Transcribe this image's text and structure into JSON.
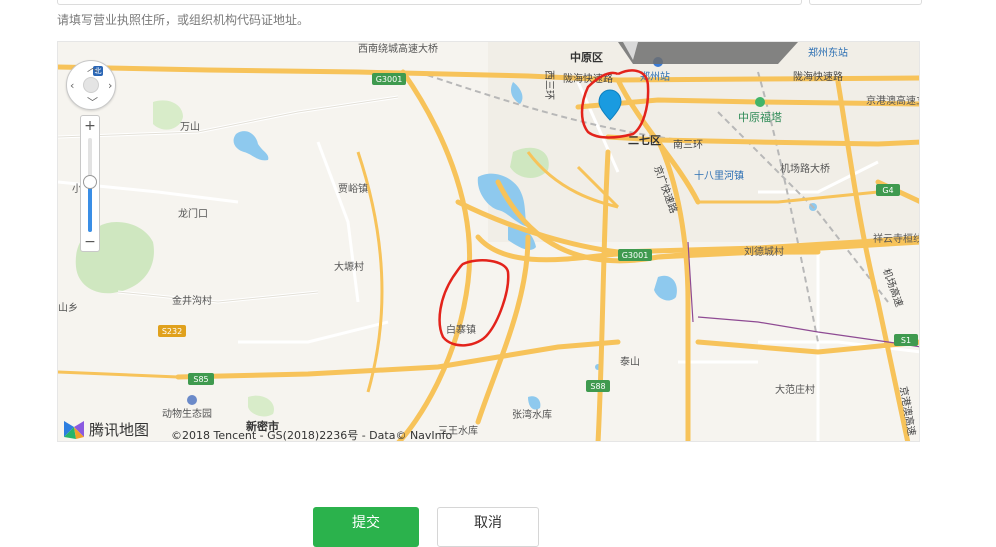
{
  "form": {
    "hint": "请填写营业执照住所，或组织机构代码证地址。",
    "submit_label": "提交",
    "cancel_label": "取消"
  },
  "map": {
    "provider_name": "腾讯地图",
    "copyright": "©2018 Tencent - GS(2018)2236号 - Data© NavInfo",
    "zoom_level_fraction": 0.55,
    "labels": {
      "zhongyuan_qu": "中原区",
      "zhengzhou_dongzhan": "郑州东站",
      "zhengzhou_zhan": "郑州站",
      "longhai_kuaisu": "陇海快速路",
      "longhai_kuaisu_2": "陇海快速路",
      "xisanhuan": "西三环",
      "xinan_raocheng": "西南绕城高速大桥",
      "erqi_qu": "二七区",
      "nansanhuan": "南三环",
      "zhongyuan_futa": "中原福塔",
      "jinggangao_lijiaoqiao": "京港澳高速立交桥",
      "jichang_dajie": "机场路大桥",
      "shibalihe": "十八里河镇",
      "jingguang_kuaisu": "京广快速路",
      "jiayu_zhen": "贾峪镇",
      "fangshan": "万山",
      "longmenkou": "龙门口",
      "xiao_cun": "小村",
      "dahui_cun": "大塬村",
      "jinjinggou_cun": "金井沟村",
      "shan_xiang": "山乡",
      "liudecheng_cun": "刘德城村",
      "xiangyun_si": "祥云寺桓线",
      "jichang_gaosu": "机场高速",
      "baizhai_zhen": "白寨镇",
      "taishan": "泰山",
      "dafanzhuang_cun": "大范庄村",
      "dongwu_shengtaiyuan": "动物生态园",
      "xinmi_shi": "新密市",
      "zhangwan_shuiku": "张湾水库",
      "sanmai_shuiku": "三王水库",
      "jinggang_gaosu_v": "京港澳高速"
    },
    "shields": {
      "g3001_top": "G3001",
      "g3001_mid": "G3001",
      "g4": "G4",
      "s232": "S232",
      "s85": "S85",
      "s88": "S88",
      "s1": "S1"
    },
    "colors": {
      "road_major": "#f7c35a",
      "road_minor": "#ffffff",
      "water": "#8ec9ee",
      "park": "#cfe7c0",
      "annotation": "#e3231b",
      "marker": "#1a9be0",
      "shield_green": "#3f9a4f",
      "shield_orange": "#e0a11d"
    }
  }
}
